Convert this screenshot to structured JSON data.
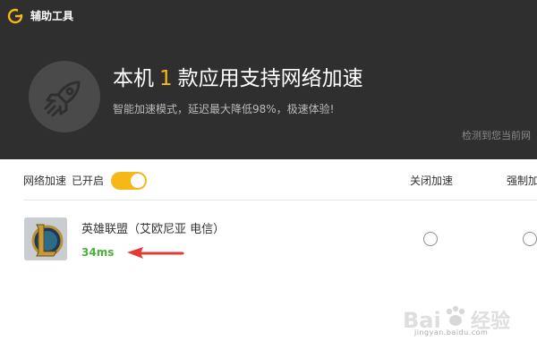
{
  "app": {
    "title": "辅助工具"
  },
  "banner": {
    "prefix": "本机",
    "count": "1",
    "suffix": "款应用支持网络加速",
    "subtitle": "智能加速模式，延迟最大降低98%，极速体验!",
    "detect_note": "检测到您当前网"
  },
  "toolbar": {
    "network_label": "网络加速",
    "status": "已开启",
    "toggle_on": true,
    "col_close": "关闭加速",
    "col_force": "强制加速"
  },
  "games": [
    {
      "name": "英雄联盟（艾欧尼亚 电信）",
      "ping": "34ms"
    }
  ],
  "watermark": {
    "brand": "Baidu 经验",
    "url": "jingyan.baidu.com"
  },
  "colors": {
    "accent": "#f6b818",
    "header_bg": "#2f2f2f",
    "ping_green": "#4caf3a",
    "arrow_red": "#e53935"
  }
}
